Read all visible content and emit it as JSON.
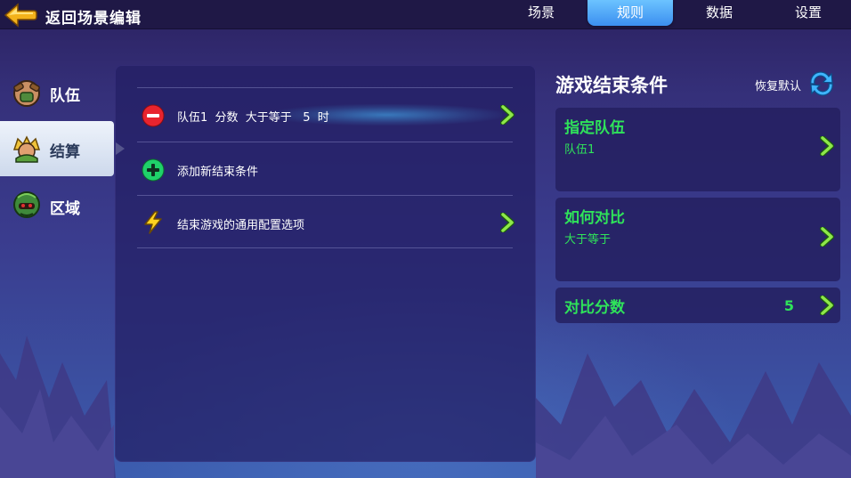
{
  "header": {
    "back_label": "返回场景编辑",
    "tabs": [
      {
        "label": "场景",
        "active": false
      },
      {
        "label": "规则",
        "active": true
      },
      {
        "label": "数据",
        "active": false
      },
      {
        "label": "设置",
        "active": false
      }
    ]
  },
  "sidebar": {
    "items": [
      {
        "label": "队伍",
        "icon": "team-icon",
        "active": false
      },
      {
        "label": "结算",
        "icon": "settlement-icon",
        "active": true
      },
      {
        "label": "区域",
        "icon": "region-icon",
        "active": false
      }
    ]
  },
  "conditions": {
    "rows": [
      {
        "text": "队伍1  分数  大于等于   5  时",
        "icon": "remove-icon"
      },
      {
        "text": "添加新结束条件",
        "icon": "add-icon"
      },
      {
        "text": "结束游戏的通用配置选项",
        "icon": "lightning-icon"
      }
    ]
  },
  "detail": {
    "title": "游戏结束条件",
    "reset_label": "恢复默认",
    "cards": [
      {
        "title": "指定队伍",
        "value": "队伍1"
      },
      {
        "title": "如何对比",
        "value": "大于等于"
      },
      {
        "title": "对比分数",
        "value": "5"
      }
    ]
  },
  "colors": {
    "accent_green": "#2fe35a",
    "tab_active": "#3b8ff0",
    "remove_red": "#e8242e",
    "topbar": "#1f1846"
  }
}
